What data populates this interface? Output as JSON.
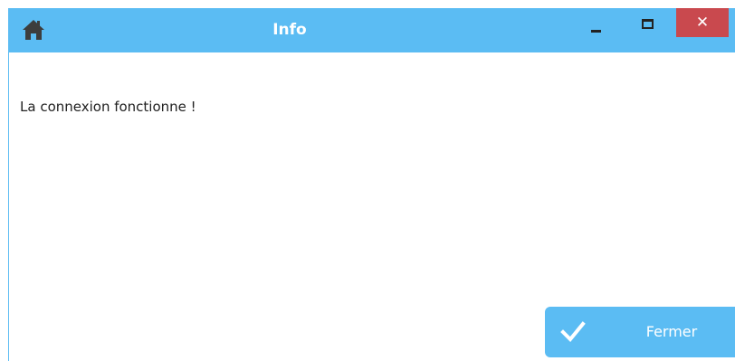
{
  "window": {
    "title": "Info",
    "icon": "home-icon",
    "controls": {
      "minimize_icon": "minimize-icon",
      "maximize_icon": "maximize-icon",
      "close_label": "✕"
    }
  },
  "dialog": {
    "message": "La connexion fonctionne !",
    "close_button": {
      "icon": "check-icon",
      "label": "Fermer"
    }
  },
  "colors": {
    "accent": "#5bbcf3",
    "close": "#c9494e",
    "text": "#222222"
  }
}
